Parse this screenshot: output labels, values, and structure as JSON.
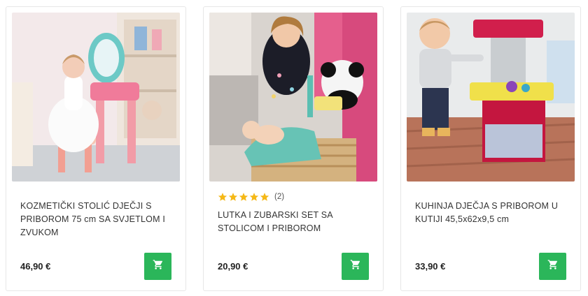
{
  "colors": {
    "accent": "#2bb65a",
    "star": "#f5b816"
  },
  "products": [
    {
      "title": "KOZMETIČKI STOLIĆ DJEČJI S PRIBOROM 75 cm SA SVJETLOM I ZVUKOM",
      "price": "46,90 €",
      "image": "girl-vanity-table-photo"
    },
    {
      "title": "LUTKA I ZUBARSKI SET SA STOLICOM I PRIBOROM",
      "price": "20,90 €",
      "rating": 5,
      "rating_count": "(2)",
      "image": "girl-dentist-doll-set-photo"
    },
    {
      "title": "KUHINJA DJEČJA S PRIBOROM U KUTIJI 45,5x62x9,5 cm",
      "price": "33,90 €",
      "image": "toddler-kitchen-photo"
    }
  ],
  "icons": {
    "cart": "cart-icon",
    "star": "star-icon"
  }
}
